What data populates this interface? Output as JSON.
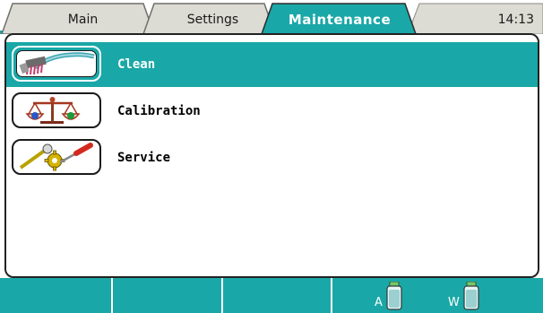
{
  "tabs": [
    {
      "label": "Main",
      "active": false
    },
    {
      "label": "Settings",
      "active": false
    },
    {
      "label": "Maintenance",
      "active": true
    }
  ],
  "clock": "14:13",
  "menu": [
    {
      "label": "Clean",
      "icon": "cleaning-brush-icon",
      "selected": true
    },
    {
      "label": "Calibration",
      "icon": "balance-scale-icon",
      "selected": false
    },
    {
      "label": "Service",
      "icon": "service-tools-icon",
      "selected": false
    }
  ],
  "status": {
    "bottle_a_label": "A",
    "bottle_w_label": "W"
  },
  "colors": {
    "accent": "#1aa7a7",
    "tab_inactive": "#dcdcd4",
    "text": "#000000"
  }
}
